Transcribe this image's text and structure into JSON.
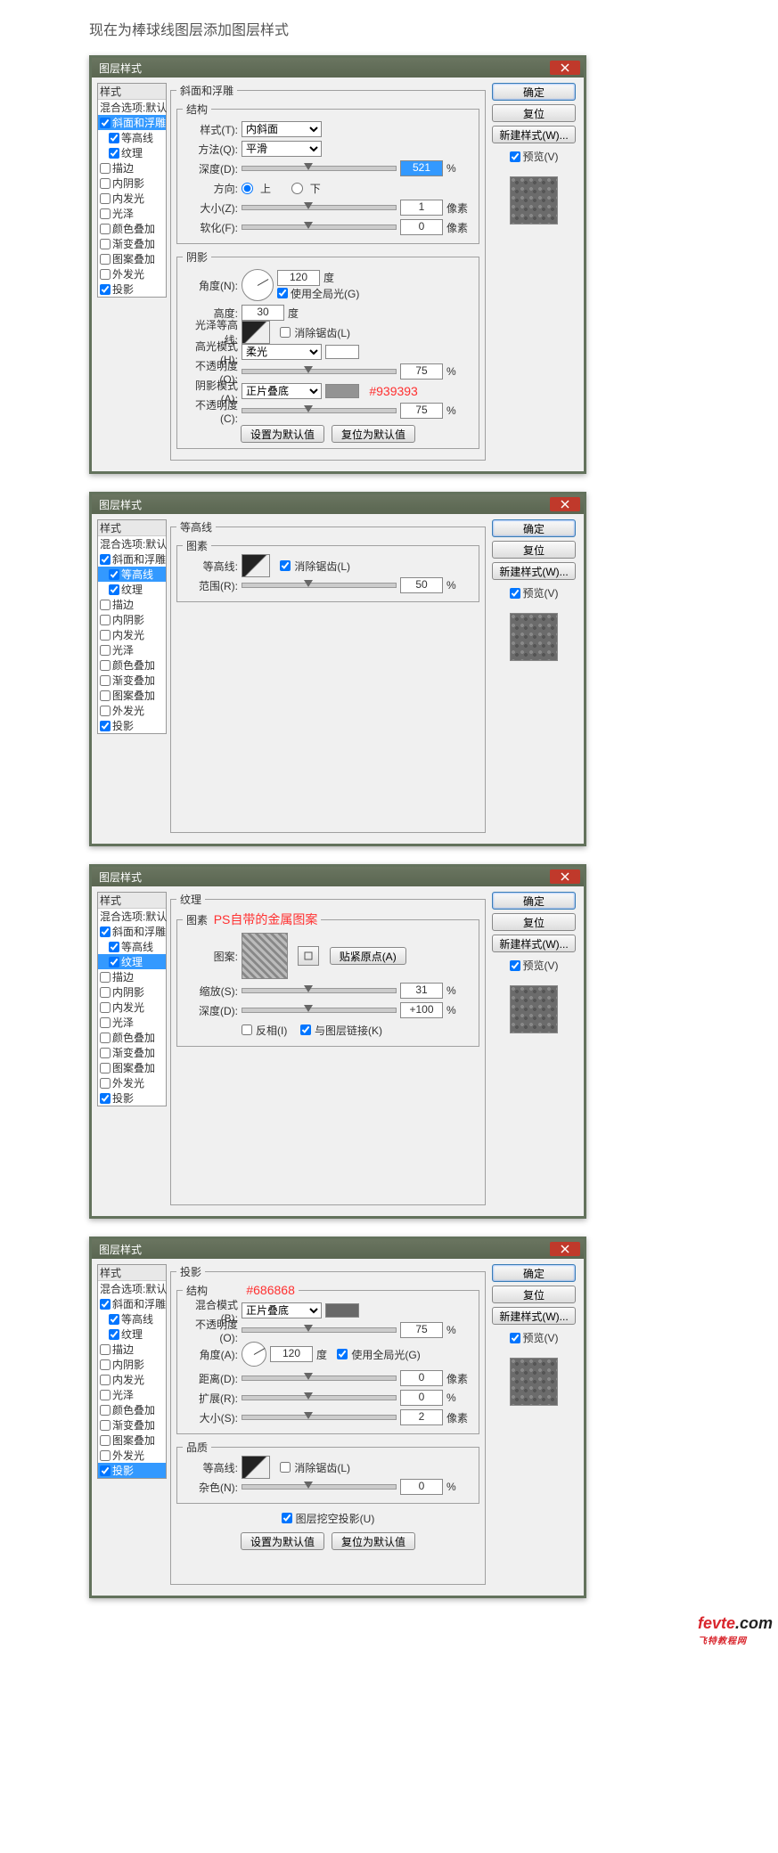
{
  "header": "现在为棒球线图层添加图层样式",
  "dlg_title": "图层样式",
  "styles": {
    "title": "样式",
    "blend": "混合选项:默认",
    "items": [
      "斜面和浮雕",
      "等高线",
      "纹理",
      "描边",
      "内阴影",
      "内发光",
      "光泽",
      "颜色叠加",
      "渐变叠加",
      "图案叠加",
      "外发光",
      "投影"
    ]
  },
  "buttons": {
    "ok": "确定",
    "cancel": "复位",
    "new_style": "新建样式(W)...",
    "preview": "预览(V)",
    "set_default": "设置为默认值",
    "reset_default": "复位为默认值",
    "snap": "贴紧原点(A)"
  },
  "panel1": {
    "group": "斜面和浮雕",
    "struct": "结构",
    "shading": "阴影",
    "style_l": "样式(T):",
    "style_v": "内斜面",
    "tech_l": "方法(Q):",
    "tech_v": "平滑",
    "depth_l": "深度(D):",
    "depth_v": "521",
    "pct": "%",
    "dir_l": "方向:",
    "up": "上",
    "down": "下",
    "size_l": "大小(Z):",
    "size_v": "1",
    "px": "像素",
    "soft_l": "软化(F):",
    "soft_v": "0",
    "angle_l": "角度(N):",
    "angle_v": "120",
    "deg": "度",
    "global": "使用全局光(G)",
    "alt_l": "高度:",
    "alt_v": "30",
    "gloss_l": "光泽等高线:",
    "anti": "消除锯齿(L)",
    "hmode_l": "高光模式(H):",
    "hmode_v": "柔光",
    "hopac_l": "不透明度(O):",
    "hopac_v": "75",
    "smode_l": "阴影模式(A):",
    "smode_v": "正片叠底",
    "sopac_l": "不透明度(C):",
    "sopac_v": "75",
    "annot": "#939393"
  },
  "panel2": {
    "group": "等高线",
    "elem": "图素",
    "contour_l": "等高线:",
    "anti": "消除锯齿(L)",
    "range_l": "范围(R):",
    "range_v": "50",
    "pct": "%"
  },
  "panel3": {
    "group": "纹理",
    "elem": "图素",
    "annot": "PS自带的金属图案",
    "pattern_l": "图案:",
    "scale_l": "缩放(S):",
    "scale_v": "31",
    "pct": "%",
    "depth_l": "深度(D):",
    "depth_v": "+100",
    "invert": "反相(I)",
    "link": "与图层链接(K)"
  },
  "panel4": {
    "group": "投影",
    "struct": "结构",
    "qual": "品质",
    "annot": "#686868",
    "bmode_l": "混合模式(B):",
    "bmode_v": "正片叠底",
    "opac_l": "不透明度(O):",
    "opac_v": "75",
    "pct": "%",
    "angle_l": "角度(A):",
    "angle_v": "120",
    "deg": "度",
    "global": "使用全局光(G)",
    "dist_l": "距离(D):",
    "dist_v": "0",
    "px": "像素",
    "spread_l": "扩展(R):",
    "spread_v": "0",
    "size_l": "大小(S):",
    "size_v": "2",
    "contour_l": "等高线:",
    "anti": "消除锯齿(L)",
    "noise_l": "杂色(N):",
    "noise_v": "0",
    "knockout": "图层挖空投影(U)"
  },
  "logo": {
    "a": "fevte",
    "b": ".com",
    "sub": "飞特教程网"
  }
}
